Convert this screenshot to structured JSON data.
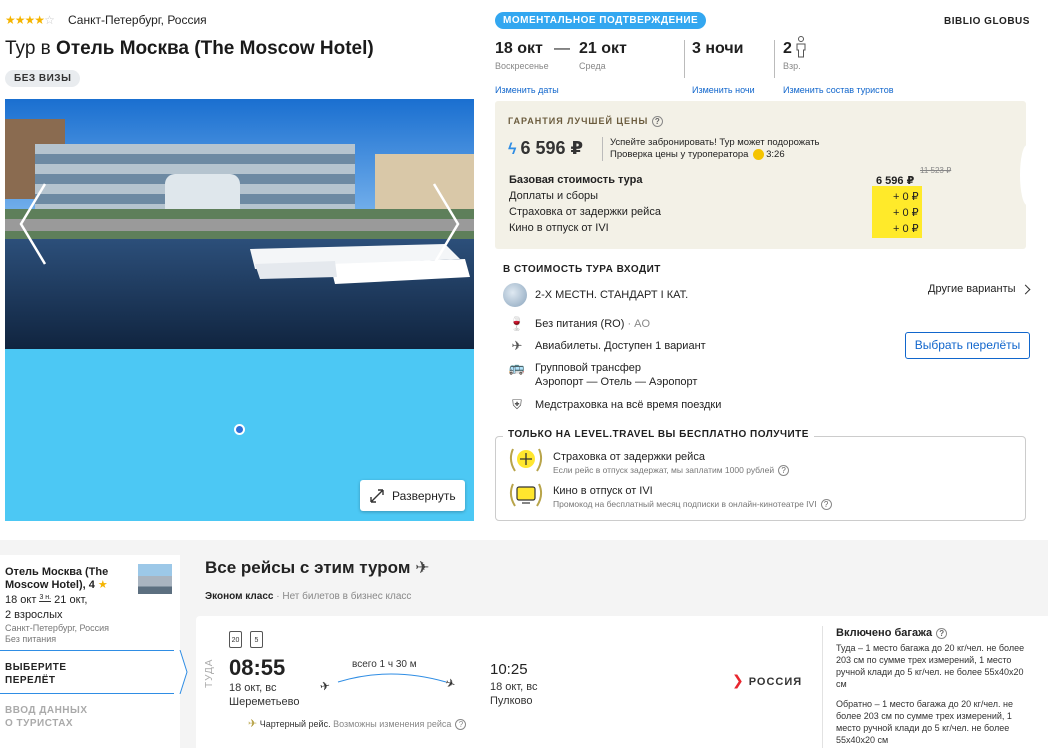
{
  "hotel": {
    "stars": 4,
    "location": "Санкт-Петербург, Россия",
    "title_prefix": "Тур в",
    "title_name": "Отель Москва (The Moscow Hotel)",
    "visa_badge": "БЕЗ ВИЗЫ"
  },
  "gallery": {
    "expand_label": "Развернуть"
  },
  "header": {
    "instant_badge": "МОМЕНТАЛЬНОЕ ПОДТВЕРЖДЕНИЕ",
    "operator": "BIBLIO GLOBUS",
    "date_from": "18 окт",
    "date_from_day": "Воскресенье",
    "dash": "—",
    "date_to": "21 окт",
    "date_to_day": "Среда",
    "nights": "3 ночи",
    "adults": "2",
    "adults_label": "Взр.",
    "change_dates": "Изменить даты",
    "change_nights": "Изменить ночи",
    "change_tourists": "Изменить состав туристов"
  },
  "price": {
    "guarantee_title": "ГАРАНТИЯ ЛУЧШЕЙ ЦЕНЫ",
    "help": "?",
    "main": "6 596 ₽",
    "note_line1": "Успейте забронировать! Тур может подорожать",
    "note_line2": "Проверка цены у туроператора",
    "timer": "3:26",
    "old_price": "11 523 ₽",
    "rows": [
      {
        "label": "Базовая стоимость тура",
        "value": "6 596 ₽"
      },
      {
        "label": "Доплаты и сборы",
        "value": "+ 0 ₽"
      },
      {
        "label": "Страховка от задержки рейса",
        "value": "+ 0 ₽"
      },
      {
        "label": "Кино в отпуск от IVI",
        "value": "+ 0 ₽"
      }
    ]
  },
  "included": {
    "title": "В СТОИМОСТЬ ТУРА ВХОДИТ",
    "room": "2-Х МЕСТН. СТАНДАРТ I КАТ.",
    "other_variants": "Другие варианты",
    "meal": "Без питания (RO)",
    "meal_code": "· AO",
    "flights": "Авиабилеты. Доступен 1 вариант",
    "choose_flights": "Выбрать перелёты",
    "transfer_line1": "Групповой трансфер",
    "transfer_line2": "Аэропорт — Отель — Аэропорт",
    "insurance": "Медстраховка на всё время поездки"
  },
  "level_travel": {
    "title": "ТОЛЬКО НА LEVEL.TRAVEL ВЫ БЕСПЛАТНО ПОЛУЧИТЕ",
    "perk1_title": "Страховка от задержки рейса",
    "perk1_sub": "Если рейс в отпуск задержат, мы заплатим 1000 рублей",
    "perk2_title": "Кино в отпуск от IVI",
    "perk2_sub": "Промокод на бесплатный месяц подписки в онлайн-кинотеатре IVI"
  },
  "side_card": {
    "hotel_line1": "Отель Москва (The",
    "hotel_line2": "Moscow Hotel), 4",
    "dates_from": "18 окт",
    "nights_short": "3 н.",
    "dates_to": "21 окт,",
    "guests": "2 взрослых",
    "location": "Санкт-Петербург, Россия",
    "meal": "Без питания",
    "step_active_line1": "ВЫБЕРИТЕ",
    "step_active_line2": "ПЕРЕЛЁТ",
    "step_next_line1": "ВВОД ДАННЫХ",
    "step_next_line2": "О ТУРИСТАХ"
  },
  "flights": {
    "section_title": "Все рейсы с этим туром",
    "class_name": "Эконом класс",
    "class_note": "· Нет билетов в бизнес класс",
    "direction": "ТУДА",
    "bag_kg": "20",
    "hand_kg": "5",
    "dep_time": "08:55",
    "dep_date": "18 окт, вс",
    "dep_airport": "Шереметьево",
    "duration": "всего 1 ч 30 м",
    "arr_time": "10:25",
    "arr_date": "18 окт, вс",
    "arr_airport": "Пулково",
    "charter": "Чартерный рейс.",
    "charter_note": "Возможны изменения рейса",
    "airline": "РОССИЯ",
    "baggage_title": "Включено багажа",
    "baggage_there": "Туда – 1 место багажа до 20 кг/чел. не более 203 см по сумме трех измерений, 1 место ручной клади до 5 кг/чел. не более 55х40х20 см",
    "baggage_back": "Обратно – 1 место багажа до 20 кг/чел. не более 203 см по сумме трех измерений, 1 место ручной клади до 5 кг/чел. не более 55х40х20 см"
  }
}
